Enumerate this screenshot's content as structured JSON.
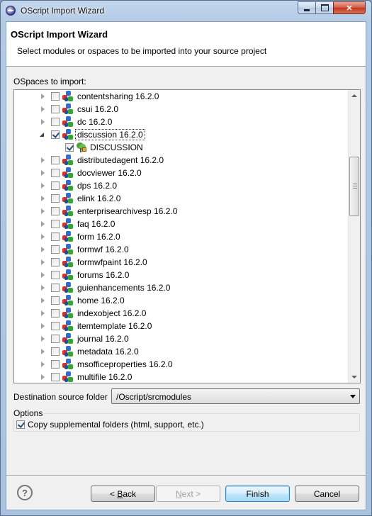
{
  "window": {
    "title": "OScript Import Wizard",
    "close_glyph": "✕"
  },
  "header": {
    "title": "OScript Import Wizard",
    "description": "Select modules or ospaces to be imported into your source project"
  },
  "tree": {
    "label": "OSpaces to import:",
    "rows": [
      {
        "label": "contentsharing 16.2.0",
        "expanded": false,
        "checked": false,
        "level": 0
      },
      {
        "label": "csui 16.2.0",
        "expanded": false,
        "checked": false,
        "level": 0
      },
      {
        "label": "dc 16.2.0",
        "expanded": false,
        "checked": false,
        "level": 0
      },
      {
        "label": "discussion 16.2.0",
        "expanded": true,
        "checked": true,
        "level": 0,
        "selected": true
      },
      {
        "label": "DISCUSSION",
        "expanded": null,
        "checked": true,
        "level": 1
      },
      {
        "label": "distributedagent 16.2.0",
        "expanded": false,
        "checked": false,
        "level": 0
      },
      {
        "label": "docviewer 16.2.0",
        "expanded": false,
        "checked": false,
        "level": 0
      },
      {
        "label": "dps 16.2.0",
        "expanded": false,
        "checked": false,
        "level": 0
      },
      {
        "label": "elink 16.2.0",
        "expanded": false,
        "checked": false,
        "level": 0
      },
      {
        "label": "enterprisearchivesp 16.2.0",
        "expanded": false,
        "checked": false,
        "level": 0
      },
      {
        "label": "faq 16.2.0",
        "expanded": false,
        "checked": false,
        "level": 0
      },
      {
        "label": "form 16.2.0",
        "expanded": false,
        "checked": false,
        "level": 0
      },
      {
        "label": "formwf 16.2.0",
        "expanded": false,
        "checked": false,
        "level": 0
      },
      {
        "label": "formwfpaint 16.2.0",
        "expanded": false,
        "checked": false,
        "level": 0
      },
      {
        "label": "forums 16.2.0",
        "expanded": false,
        "checked": false,
        "level": 0
      },
      {
        "label": "guienhancements 16.2.0",
        "expanded": false,
        "checked": false,
        "level": 0
      },
      {
        "label": "home 16.2.0",
        "expanded": false,
        "checked": false,
        "level": 0
      },
      {
        "label": "indexobject 16.2.0",
        "expanded": false,
        "checked": false,
        "level": 0
      },
      {
        "label": "itemtemplate 16.2.0",
        "expanded": false,
        "checked": false,
        "level": 0
      },
      {
        "label": "journal 16.2.0",
        "expanded": false,
        "checked": false,
        "level": 0
      },
      {
        "label": "metadata 16.2.0",
        "expanded": false,
        "checked": false,
        "level": 0
      },
      {
        "label": "msofficeproperties 16.2.0",
        "expanded": false,
        "checked": false,
        "level": 0
      },
      {
        "label": "multifile 16.2.0",
        "expanded": false,
        "checked": false,
        "level": 0
      }
    ]
  },
  "destination": {
    "label": "Destination source folder",
    "value": "/Oscript/srcmodules"
  },
  "options": {
    "legend": "Options",
    "copy_supplemental_label": "Copy supplemental folders (html, support, etc.)",
    "copy_supplemental_checked": true
  },
  "buttons": {
    "help_glyph": "?",
    "back_prefix": "< ",
    "back_mnemonic": "B",
    "back_rest": "ack",
    "next_prefix": "",
    "next_mnemonic": "N",
    "next_rest": "ext >",
    "finish": "Finish",
    "cancel": "Cancel"
  }
}
